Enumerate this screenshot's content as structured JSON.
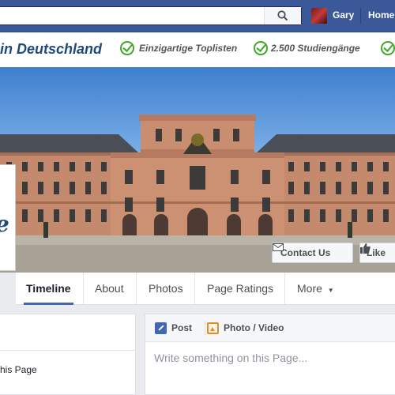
{
  "topbar": {
    "user_name": "Gary",
    "home_label": "Home"
  },
  "banner": {
    "title": "in Deutschland",
    "features": [
      "Einzigartige Toplisten",
      "2.500 Studiengänge"
    ]
  },
  "cover": {
    "contact_button": "Contact Us",
    "like_button": "Like"
  },
  "profile": {
    "logo_letter": "e"
  },
  "tabs": [
    "Timeline",
    "About",
    "Photos",
    "Page Ratings",
    "More"
  ],
  "left_card": {
    "text": "his Page"
  },
  "composer": {
    "post_tab": "Post",
    "photo_tab": "Photo / Video",
    "placeholder": "Write something on this Page..."
  },
  "colors": {
    "facebook_blue": "#3b5998",
    "check_green": "#41a62a",
    "brand_navy": "#1e4a7b"
  }
}
